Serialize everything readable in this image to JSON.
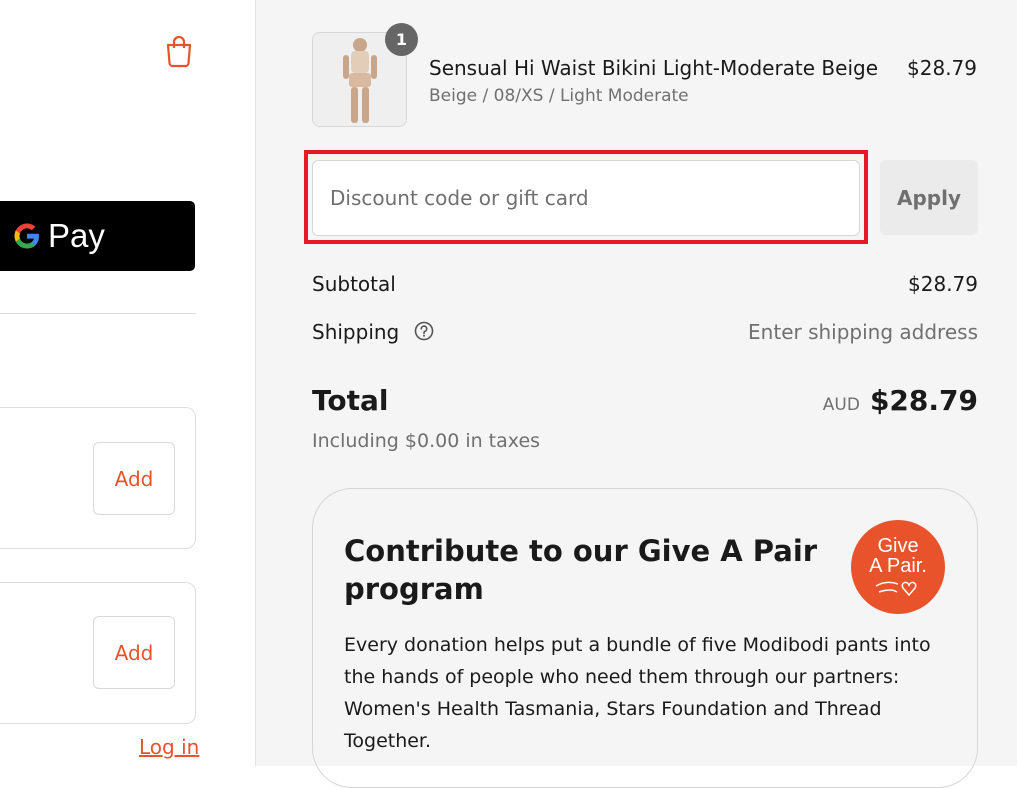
{
  "left": {
    "gpay_label": "Pay",
    "upsell_items": [
      {
        "add_label": "Add"
      },
      {
        "add_label": "Add"
      }
    ],
    "login_label": "Log in"
  },
  "cart": {
    "item": {
      "quantity": "1",
      "name": "Sensual Hi Waist Bikini Light-Moderate Beige",
      "variant": "Beige / 08/XS / Light Moderate",
      "price": "$28.79"
    },
    "discount": {
      "placeholder": "Discount code or gift card",
      "apply_label": "Apply"
    },
    "subtotal": {
      "label": "Subtotal",
      "value": "$28.79"
    },
    "shipping": {
      "label": "Shipping",
      "value": "Enter shipping address"
    },
    "total": {
      "label": "Total",
      "currency": "AUD",
      "value": "$28.79"
    },
    "taxes_note": "Including $0.00 in taxes"
  },
  "donation": {
    "title": "Contribute to our Give A Pair program",
    "body": "Every donation helps put a bundle of five Modibodi pants into the hands of people who need them through our partners: Women's Health Tasmania, Stars Foundation and Thread Together.",
    "logo_text": [
      "Give",
      "A Pair."
    ]
  },
  "colors": {
    "accent": "#e8532b",
    "highlight": "#e51a24",
    "panel_bg": "#f5f5f5"
  },
  "icons": [
    "shopping-bag-icon",
    "google-g-icon",
    "help-circle-icon",
    "product-thumbnail",
    "give-a-pair-logo"
  ]
}
